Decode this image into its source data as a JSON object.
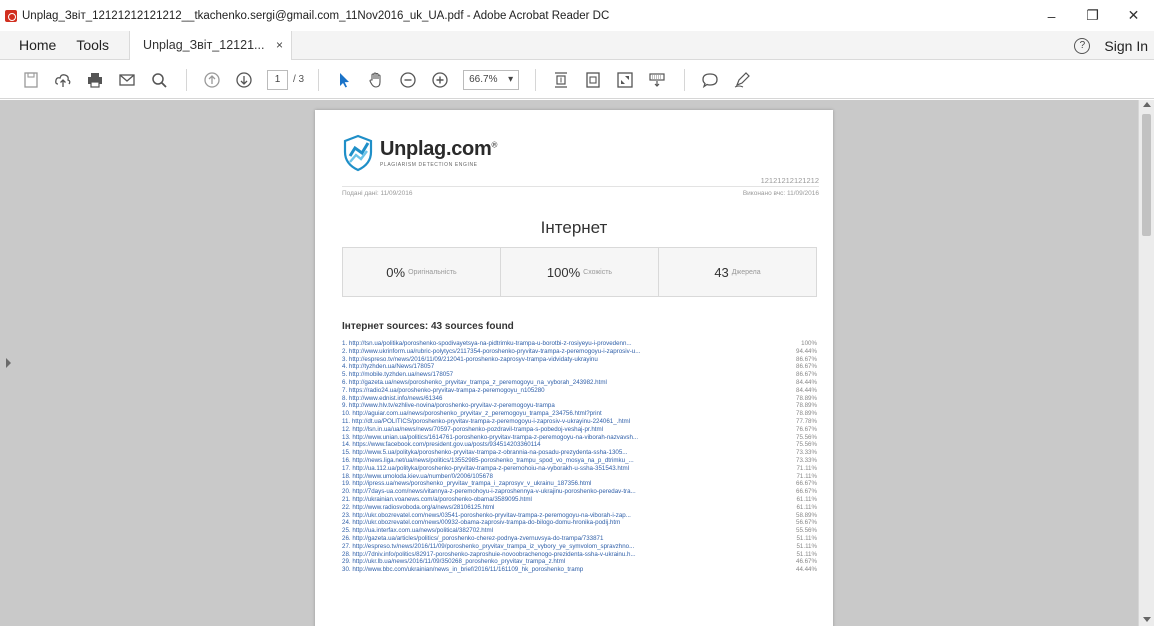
{
  "window": {
    "title": "Unplag_Звіт_12121212121212__tkachenko.sergi@gmail.com_11Nov2016_uk_UA.pdf - Adobe Acrobat Reader DC",
    "minimize": "–",
    "maximize": "❐",
    "close": "✕"
  },
  "menu": {
    "home": "Home",
    "tools": "Tools",
    "tab_label": "Unplag_Звіт_12121...",
    "tab_close": "×",
    "help": "?",
    "sign_in": "Sign In"
  },
  "toolbar": {
    "page_current": "1",
    "page_total": "/ 3",
    "zoom": "66.7%",
    "zoom_arrow": "▾"
  },
  "report": {
    "brand": "Unplag.com",
    "brand_mark": "®",
    "tagline": "PLAGIARISM DETECTION ENGINE",
    "doc_id": "12121212121212",
    "submitted": "Подані дані: 11/09/2016",
    "checked": "Виконано вчс: 11/09/2016",
    "title": "Інтернет",
    "stats": [
      {
        "value": "0%",
        "label": "Оригінальність"
      },
      {
        "value": "100%",
        "label": "Схожість"
      },
      {
        "value": "43",
        "label": "Джерела"
      }
    ],
    "sources_heading": "Інтернет sources: 43 sources found",
    "sources": [
      {
        "url": "1. http://tsn.ua/politika/poroshenko-spodivayetsya-na-pidtrimku-trampa-u-borotbi-z-rosiyeyu-i-provedenn...",
        "pct": "100%"
      },
      {
        "url": "2. http://www.ukrinform.ua/rubric-polytycs/2117354-poroshenko-pryvitav-trampa-z-peremogoyu-i-zaprosiv-u...",
        "pct": "94.44%"
      },
      {
        "url": "3. http://espreso.tv/news/2016/11/09/212041-poroshenko-zaprosyv-trampa-vidvidaty-ukrayinu",
        "pct": "86.67%"
      },
      {
        "url": "4. http://tyzhden.ua/News/178057",
        "pct": "86.67%"
      },
      {
        "url": "5. http://mobile.tyzhden.ua/news/178057",
        "pct": "86.67%"
      },
      {
        "url": "6. http://gazeta.ua/news/poroshenko_pryvitav_trampa_z_peremogoyu_na_vyborah_243982.html",
        "pct": "84.44%"
      },
      {
        "url": "7. https://radio24.ua/poroshenko-pryvitav-trampa-z-peremogoyu_n105280",
        "pct": "84.44%"
      },
      {
        "url": "8. http://www.ednist.info/news/61346",
        "pct": "78.89%"
      },
      {
        "url": "9. http://www.hlv.tv/ezhlive-novina/poroshenko-pryvitav-z-peremogoyu-trampa",
        "pct": "78.89%"
      },
      {
        "url": "10. http://aguiar.com.ua/news/poroshenko_pryvitav_z_peremogoyu_trampa_234756.html?print",
        "pct": "78.89%"
      },
      {
        "url": "11. http://dt.ua/POLITICS/poroshenko-pryvitav-trampa-z-peremogoyu-i-zaprosiv-v-ukrayinu-224061_.html",
        "pct": "77.78%"
      },
      {
        "url": "12. http://lsn.in.ua/ua/news/news/70597-poroshenko-pozdravil-trampa-s-pobedoj-veshaj-pr.html",
        "pct": "76.67%"
      },
      {
        "url": "13. http://www.unian.ua/politics/1614761-poroshenko-pryvitav-trampa-z-peremogoyu-na-viborah-nazvavsh...",
        "pct": "75.56%"
      },
      {
        "url": "14. https://www.facebook.com/president.gov.ua/posts/934514203360114",
        "pct": "75.56%"
      },
      {
        "url": "15. http://www.5.ua/polityka/poroshenko-pryvitav-trampa-z-obrannia-na-posadu-prezydenta-ssha-1305...",
        "pct": "73.33%"
      },
      {
        "url": "16. http://news.liga.net/ua/news/politics/13552985-poroshenko_trampu_spod_vo_mosya_na_p_dtrimku_...",
        "pct": "73.33%"
      },
      {
        "url": "17. http://ua.112.ua/polityka/poroshenko-pryvitav-trampa-z-peremohoiu-na-vyborakh-u-ssha-351543.html",
        "pct": "71.11%"
      },
      {
        "url": "18. http://www.umoloda.kiev.ua/number/0/2006/105678",
        "pct": "71.11%"
      },
      {
        "url": "19. http://ipress.ua/news/poroshenko_pryvitav_trampa_i_zaprosyv_v_ukrainu_187356.html",
        "pct": "66.67%"
      },
      {
        "url": "20. http://7days-ua.com/news/vitannya-z-peremohoyu-i-zaproshennya-v-ukrajinu-poroshenko-peredav-tra...",
        "pct": "66.67%"
      },
      {
        "url": "21. http://ukrainian.voanews.com/a/poroshenko-obama/3589095.html",
        "pct": "61.11%"
      },
      {
        "url": "22. http://www.radiosvoboda.org/a/news/28106125.html",
        "pct": "61.11%"
      },
      {
        "url": "23. http://ukr.obozrevatel.com/news/03541-poroshenko-pryvitav-trampa-z-peremogoyu-na-viborah-i-zap...",
        "pct": "58.89%"
      },
      {
        "url": "24. http://ukr.obozrevatel.com/news/00932-obama-zaprosiv-trampa-do-bilogo-domu-hronika-podij.htm",
        "pct": "56.67%"
      },
      {
        "url": "25. http://ua.interfax.com.ua/news/political/382702.html",
        "pct": "55.56%"
      },
      {
        "url": "26. http://gazeta.ua/articles/politics/_poroshenko-cherez-podnya-zvernuvsya-do-trampa/733871",
        "pct": "51.11%"
      },
      {
        "url": "27. http://espreso.tv/news/2016/11/09/poroshenko_pryvitav_trampa_iz_vybory_ye_symvolom_spravzhno...",
        "pct": "51.11%"
      },
      {
        "url": "28. http://7dniv.info/politics/82917-poroshenko-zaproshuie-novoobrachenogo-prezidenta-ssha-v-ukrainu.h...",
        "pct": "51.11%"
      },
      {
        "url": "29. http://ukr.lb.ua/news/2016/11/09/350268_poroshenko_pryvitav_trampa_z.html",
        "pct": "46.67%"
      },
      {
        "url": "30. http://www.bbc.com/ukrainian/news_in_brief/2016/11/161109_hk_poroshenko_tramp",
        "pct": "44.44%"
      }
    ]
  }
}
